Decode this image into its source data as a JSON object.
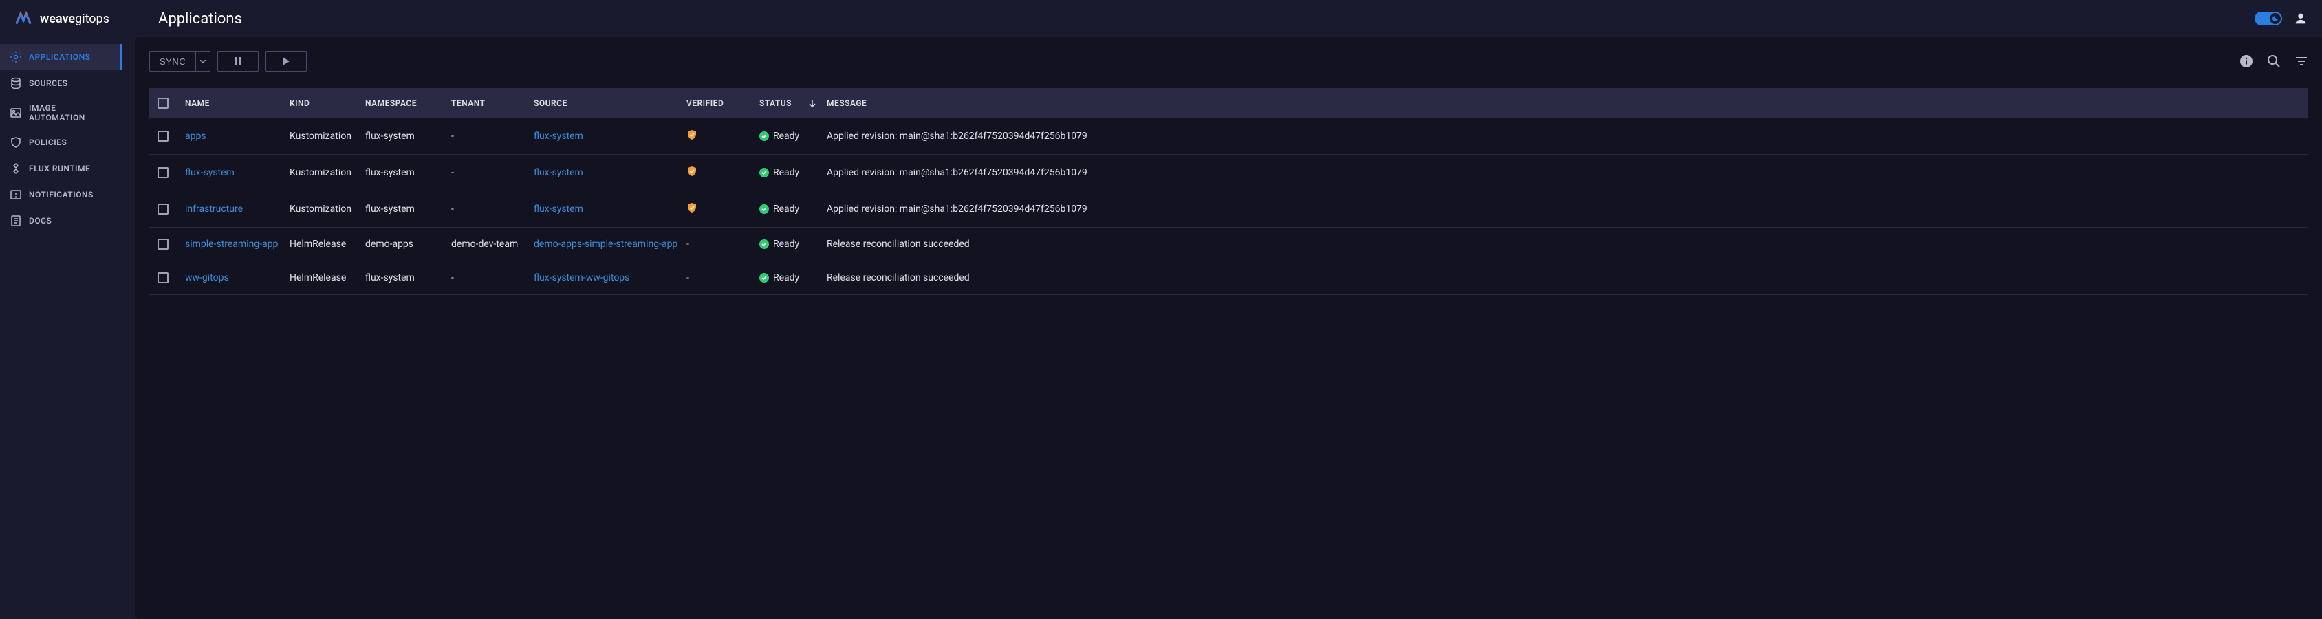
{
  "brand": {
    "name1": "weave",
    "name2": "gitops"
  },
  "page_title": "Applications",
  "sidebar": {
    "items": [
      {
        "label": "APPLICATIONS",
        "id": "applications",
        "active": true
      },
      {
        "label": "SOURCES",
        "id": "sources",
        "active": false
      },
      {
        "label": "IMAGE AUTOMATION",
        "id": "image-automation",
        "active": false
      },
      {
        "label": "POLICIES",
        "id": "policies",
        "active": false
      },
      {
        "label": "FLUX RUNTIME",
        "id": "flux-runtime",
        "active": false
      },
      {
        "label": "NOTIFICATIONS",
        "id": "notifications",
        "active": false
      },
      {
        "label": "DOCS",
        "id": "docs",
        "active": false
      }
    ]
  },
  "toolbar": {
    "sync_label": "SYNC"
  },
  "table": {
    "headers": {
      "name": "NAME",
      "kind": "KIND",
      "namespace": "NAMESPACE",
      "tenant": "TENANT",
      "source": "SOURCE",
      "verified": "VERIFIED",
      "status": "STATUS",
      "message": "MESSAGE"
    },
    "rows": [
      {
        "name": "apps",
        "kind": "Kustomization",
        "namespace": "flux-system",
        "tenant": "-",
        "source": "flux-system",
        "verified": true,
        "status": "Ready",
        "message": "Applied revision: main@sha1:b262f4f7520394d47f256b1079"
      },
      {
        "name": "flux-system",
        "kind": "Kustomization",
        "namespace": "flux-system",
        "tenant": "-",
        "source": "flux-system",
        "verified": true,
        "status": "Ready",
        "message": "Applied revision: main@sha1:b262f4f7520394d47f256b1079"
      },
      {
        "name": "infrastructure",
        "kind": "Kustomization",
        "namespace": "flux-system",
        "tenant": "-",
        "source": "flux-system",
        "verified": true,
        "status": "Ready",
        "message": "Applied revision: main@sha1:b262f4f7520394d47f256b1079"
      },
      {
        "name": "simple-streaming-app",
        "kind": "HelmRelease",
        "namespace": "demo-apps",
        "tenant": "demo-dev-team",
        "source": "demo-apps-simple-streaming-app",
        "verified": false,
        "status": "Ready",
        "message": "Release reconciliation succeeded"
      },
      {
        "name": "ww-gitops",
        "kind": "HelmRelease",
        "namespace": "flux-system",
        "tenant": "-",
        "source": "flux-system-ww-gitops",
        "verified": false,
        "status": "Ready",
        "message": "Release reconciliation succeeded"
      }
    ]
  }
}
